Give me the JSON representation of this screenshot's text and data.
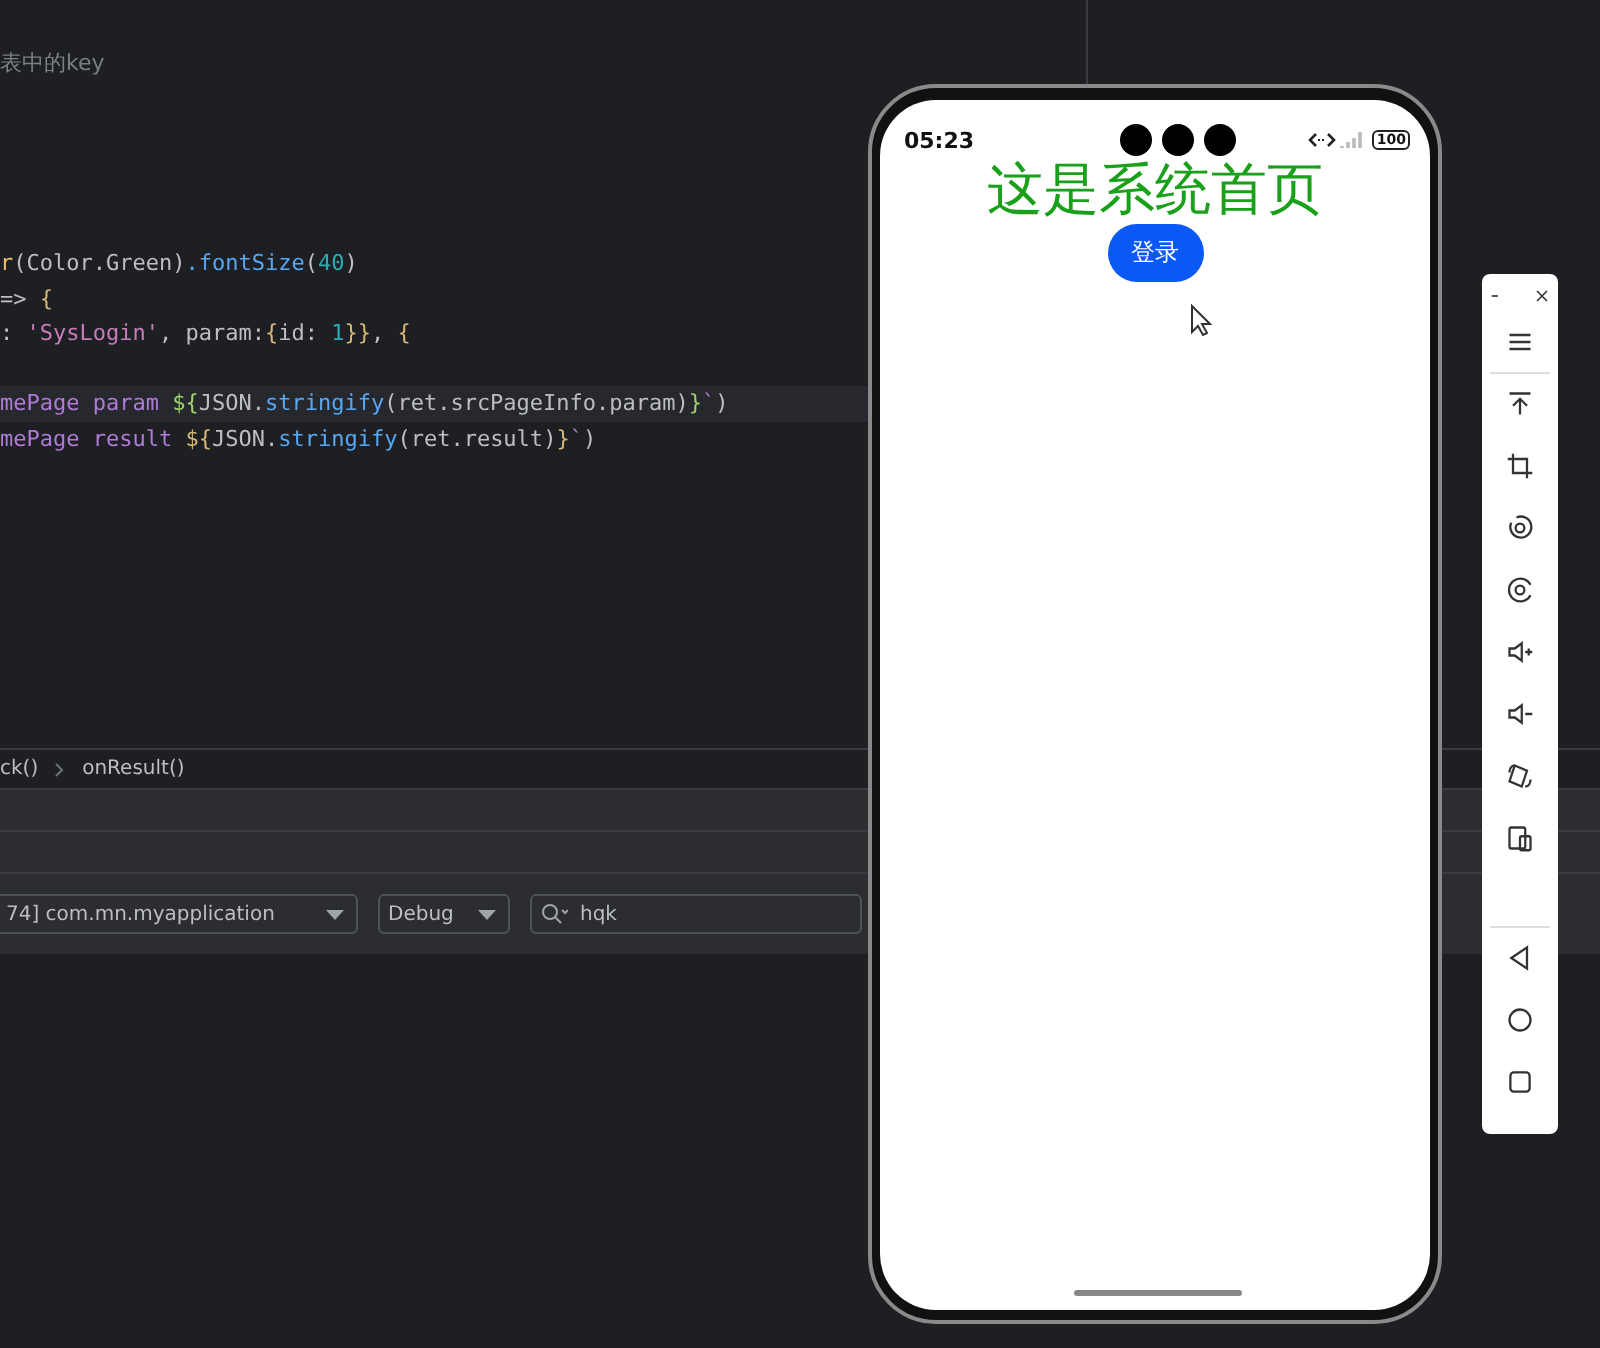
{
  "editor": {
    "comment": "表中的key",
    "code_lines": [
      {
        "highlighted": false,
        "tokens": [
          {
            "kind": "method",
            "text": "r"
          },
          {
            "kind": "paren",
            "text": "("
          },
          {
            "kind": "plain",
            "text": "Color.Green"
          },
          {
            "kind": "paren",
            "text": ")"
          },
          {
            "kind": "call",
            "text": ".fontSize"
          },
          {
            "kind": "paren",
            "text": "("
          },
          {
            "kind": "number",
            "text": "40"
          },
          {
            "kind": "paren",
            "text": ")"
          }
        ]
      },
      {
        "highlighted": false,
        "tokens": [
          {
            "kind": "plain",
            "text": "=>"
          },
          {
            "kind": "brace",
            "text": " {"
          }
        ]
      },
      {
        "highlighted": false,
        "tokens": [
          {
            "kind": "plain",
            "text": ":"
          },
          {
            "kind": "string",
            "text": " 'SysLogin'"
          },
          {
            "kind": "plain",
            "text": ", param:"
          },
          {
            "kind": "brace",
            "text": "{"
          },
          {
            "kind": "plain",
            "text": "id: "
          },
          {
            "kind": "number",
            "text": "1"
          },
          {
            "kind": "brace",
            "text": "}}"
          },
          {
            "kind": "plain",
            "text": ", "
          },
          {
            "kind": "brace",
            "text": "{"
          }
        ]
      },
      {
        "kind": "blank"
      },
      {
        "highlighted": true,
        "tokens": [
          {
            "kind": "template",
            "text": "mePage param "
          },
          {
            "kind": "interp",
            "text": "${"
          },
          {
            "kind": "plain",
            "text": "JSON."
          },
          {
            "kind": "call",
            "text": "stringify"
          },
          {
            "kind": "paren",
            "text": "("
          },
          {
            "kind": "plain",
            "text": "ret.srcPageInfo.param"
          },
          {
            "kind": "paren",
            "text": ")"
          },
          {
            "kind": "interp",
            "text": "}"
          },
          {
            "kind": "template",
            "text": "`"
          },
          {
            "kind": "paren",
            "text": ")"
          }
        ]
      },
      {
        "highlighted": false,
        "tokens": [
          {
            "kind": "template",
            "text": "mePage result "
          },
          {
            "kind": "brace",
            "text": "${"
          },
          {
            "kind": "plain",
            "text": "JSON."
          },
          {
            "kind": "call",
            "text": "stringify"
          },
          {
            "kind": "paren",
            "text": "("
          },
          {
            "kind": "plain",
            "text": "ret.result"
          },
          {
            "kind": "paren",
            "text": ")"
          },
          {
            "kind": "brace",
            "text": "}"
          },
          {
            "kind": "template",
            "text": "`"
          },
          {
            "kind": "paren",
            "text": ")"
          }
        ]
      }
    ],
    "breadcrumbs": [
      "ck()",
      "onResult()"
    ]
  },
  "log_toolbar": {
    "device": "74] com.mn.myapplication",
    "level": "Debug",
    "search": "hqk"
  },
  "phone": {
    "time": "05:23",
    "battery": "100",
    "title": "这是系统首页",
    "button": "登录"
  },
  "emulator_toolbar": {
    "tools": [
      {
        "kind": "minimize"
      },
      {
        "kind": "close"
      },
      {
        "kind": "menu"
      },
      {
        "kind": "top"
      },
      {
        "kind": "crop"
      },
      {
        "kind": "rotate"
      },
      {
        "kind": "screenshot"
      },
      {
        "kind": "volume_up"
      },
      {
        "kind": "volume_down"
      },
      {
        "kind": "rotate_device"
      },
      {
        "kind": "fold"
      },
      {
        "kind": "back"
      },
      {
        "kind": "home"
      },
      {
        "kind": "recents"
      }
    ]
  }
}
